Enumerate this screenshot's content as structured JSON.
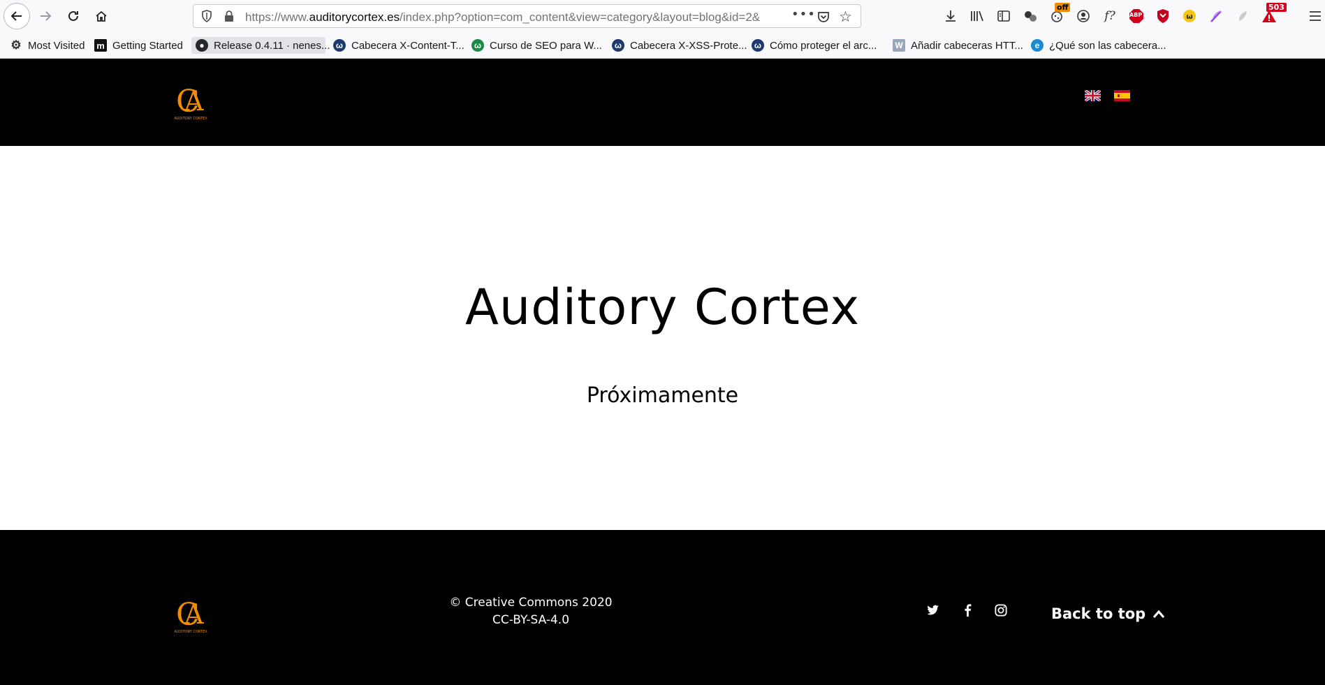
{
  "browser": {
    "url": {
      "prefix": "https://www.",
      "host": "auditorycortex.es",
      "path": "/index.php?option=com_content&view=category&layout=blog&id=2&"
    },
    "extensions": {
      "off_badge": "off",
      "fx_label": "f?",
      "abp_label": "ABP",
      "alert_badge": "503"
    },
    "bookmarks": [
      {
        "label": "Most Visited",
        "icon": "gear-icon"
      },
      {
        "label": "Getting Started",
        "icon": "m-logo-icon"
      },
      {
        "label": "Release 0.4.11 · nenes...",
        "icon": "github-icon"
      },
      {
        "label": "Cabecera X-Content-T...",
        "icon": "w-circle-icon"
      },
      {
        "label": "Curso de SEO para W...",
        "icon": "w-circle-icon"
      },
      {
        "label": "Cabecera X-XSS-Prote...",
        "icon": "w-circle-icon"
      },
      {
        "label": "Cómo proteger el arc...",
        "icon": "w-circle-icon"
      },
      {
        "label": "Añadir cabeceras HTT...",
        "icon": "wordpress-icon"
      },
      {
        "label": "¿Qué son las cabecera...",
        "icon": "blue-e-icon"
      }
    ]
  },
  "header": {
    "logo_text": "AUDITORY CORTEX",
    "logo_letters": "CA",
    "languages": [
      "English",
      "Español"
    ]
  },
  "hero": {
    "title": "Auditory Cortex",
    "subtitle": "Próximamente"
  },
  "footer": {
    "copyright": "© Creative Commons 2020",
    "license": "CC-BY-SA-4.0",
    "social": [
      "twitter-icon",
      "facebook-icon",
      "instagram-icon"
    ],
    "back_to_top": "Back to top"
  },
  "colors": {
    "logo_orange": "#f08c00",
    "header_bg": "#000000",
    "page_bg": "#ffffff"
  }
}
